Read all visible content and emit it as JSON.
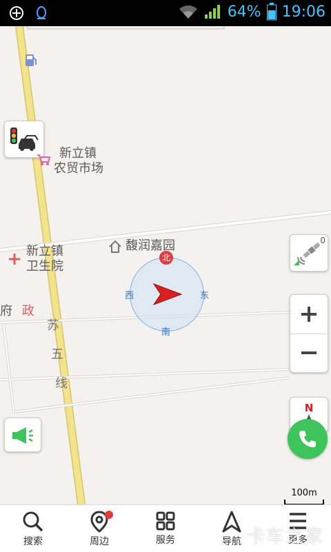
{
  "status_bar": {
    "battery_percent": "64%",
    "time": "19:06"
  },
  "map": {
    "pois": [
      {
        "id": "market",
        "lines": [
          "新立镇",
          "农贸市场"
        ]
      },
      {
        "id": "residence",
        "lines": [
          "馥润嘉园"
        ]
      },
      {
        "id": "clinic",
        "lines": [
          "新立镇",
          "卫生院"
        ]
      },
      {
        "id": "govt_a",
        "lines": [
          "府"
        ]
      },
      {
        "id": "govt_b",
        "lines": [
          "政"
        ]
      }
    ],
    "road_name_chars": [
      "苏",
      "五",
      "线"
    ],
    "compass": {
      "north": "北",
      "south": "南",
      "east": "东",
      "west": "西"
    },
    "gps_count": "0",
    "north_letter": "N",
    "scale": "100m"
  },
  "colors": {
    "road_yellow": "#f3e38a",
    "accent_green": "#3dc55c",
    "north_red": "#e23b3b"
  },
  "tabs": [
    {
      "label": "搜索",
      "icon": "search-icon"
    },
    {
      "label": "周边",
      "icon": "location-pin-icon"
    },
    {
      "label": "服务",
      "icon": "grid-icon"
    },
    {
      "label": "导航",
      "icon": "navigation-arrow-icon"
    },
    {
      "label": "更多",
      "icon": "menu-icon"
    }
  ],
  "watermark": "卡车之家"
}
